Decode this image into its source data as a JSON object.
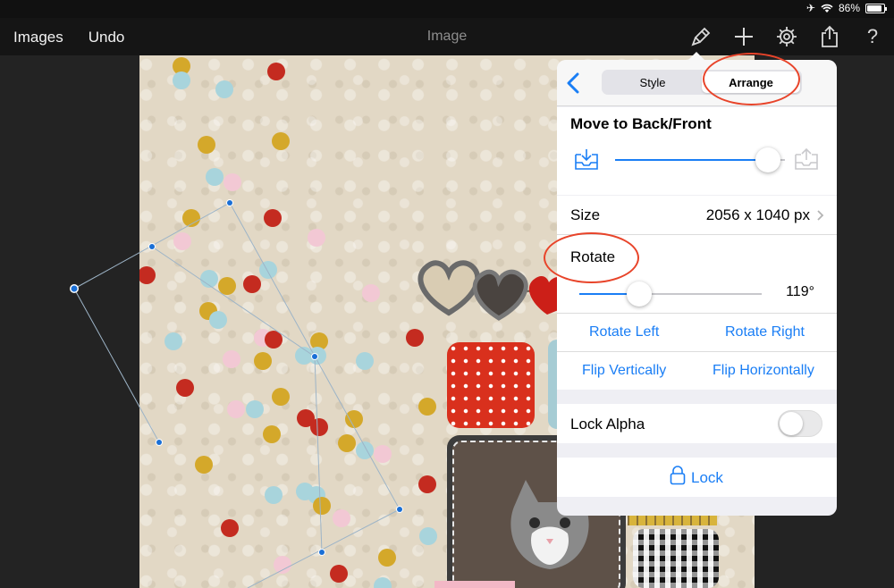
{
  "status_bar": {
    "battery": "86%"
  },
  "nav": {
    "images_label": "Images",
    "undo_label": "Undo",
    "title": "Image"
  },
  "popover": {
    "tabs": [
      "Style",
      "Arrange"
    ],
    "active_tab": "Arrange",
    "move_title": "Move to Back/Front",
    "move_level": 0.9,
    "size_label": "Size",
    "size_value": "2056 x 1040 px",
    "rotate_label": "Rotate",
    "rotate_value": "119°",
    "rotate_fraction": 0.33,
    "rotate_left": "Rotate Left",
    "rotate_right": "Rotate Right",
    "flip_vertical": "Flip Vertically",
    "flip_horizontal": "Flip Horizontally",
    "lock_alpha_label": "Lock Alpha",
    "lock_alpha_on": false,
    "lock_label": "Lock"
  },
  "colors": {
    "accent": "#1a7ef5",
    "annotation": "#e8442a"
  }
}
